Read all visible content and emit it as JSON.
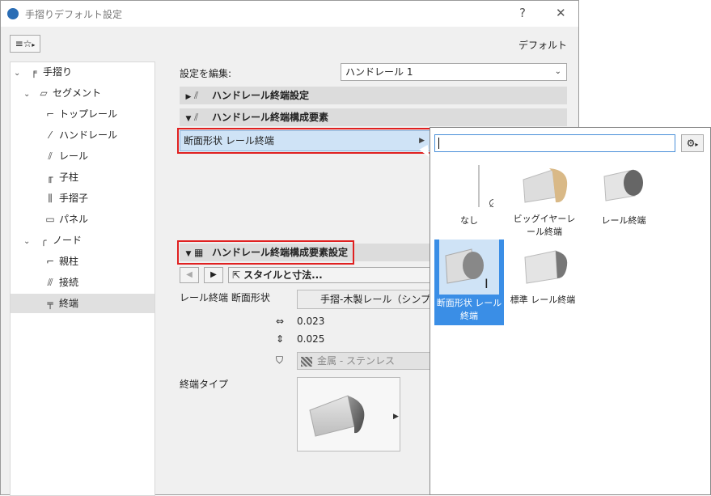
{
  "window": {
    "title": "手摺りデフォルト設定",
    "help": "?",
    "close": "✕"
  },
  "toolbar": {
    "preset_glyph": "☆",
    "default_label": "デフォルト"
  },
  "tree": [
    {
      "label": "手摺り",
      "icon": "railing-icon"
    },
    {
      "label": "セグメント",
      "icon": "segment-icon"
    },
    {
      "label": "トップレール",
      "icon": "toprail-icon"
    },
    {
      "label": "ハンドレール",
      "icon": "handrail-icon"
    },
    {
      "label": "レール",
      "icon": "rail-icon"
    },
    {
      "label": "子柱",
      "icon": "post-icon"
    },
    {
      "label": "手摺子",
      "icon": "baluster-icon"
    },
    {
      "label": "パネル",
      "icon": "panel-icon"
    },
    {
      "label": "ノード",
      "icon": "node-icon"
    },
    {
      "label": "親柱",
      "icon": "main-post-icon"
    },
    {
      "label": "接続",
      "icon": "connection-icon"
    },
    {
      "label": "終端",
      "icon": "end-icon"
    }
  ],
  "edit": {
    "label": "設定を編集:",
    "value": "ハンドレール 1"
  },
  "sections": {
    "end_settings": "ハンドレール終端設定",
    "end_components": "ハンドレール終端構成要素",
    "component_settings": "ハンドレール終端構成要素設定"
  },
  "profile_row": {
    "label": "断面形状 レール終端"
  },
  "style_button": "スタイルと寸法...",
  "props": {
    "profile_label": "レール終端 断面形状",
    "profile_value": "手摺-木製レール（シンプル）",
    "dim1": "0.023",
    "dim2": "0.025",
    "material": "金属 - ステンレス",
    "end_type_label": "終端タイプ"
  },
  "popup": {
    "search_value": "",
    "tiles": [
      {
        "label": "なし"
      },
      {
        "label": "ビッグイヤーレール終端"
      },
      {
        "label": "レール終端"
      },
      {
        "label": "断面形状 レール終端"
      },
      {
        "label": "標準 レール終端"
      }
    ]
  }
}
